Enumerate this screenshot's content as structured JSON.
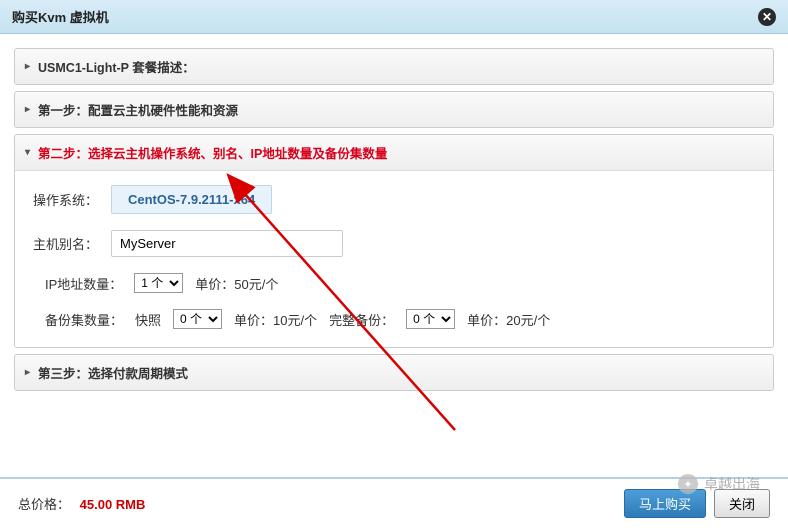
{
  "header": {
    "title": "购买Kvm 虚拟机"
  },
  "accordion": {
    "item1": {
      "label": "USMC1-Light-P 套餐描述："
    },
    "item2": {
      "label": "第一步：配置云主机硬件性能和资源"
    },
    "item3": {
      "label": "第二步：选择云主机操作系统、别名、IP地址数量及备份集数量"
    },
    "item4": {
      "label": "第三步：选择付款周期模式"
    }
  },
  "form": {
    "os_label": "操作系统：",
    "os_value": "CentOS-7.9.2111-x64",
    "alias_label": "主机别名：",
    "alias_value": "MyServer",
    "ip_label": "IP地址数量：",
    "ip_select": "1 个",
    "ip_unit": "单价：50元/个",
    "backup_label": "备份集数量：",
    "snapshot_label": "快照",
    "snapshot_select": "0 个",
    "snapshot_unit": "单价：10元/个",
    "full_label": "完整备份：",
    "full_select": "0 个",
    "full_unit": "单价：20元/个"
  },
  "footer": {
    "total_label": "总价格：",
    "total_price": "45.00 RMB",
    "buy_label": "马上购买",
    "close_label": "关闭"
  },
  "watermark": {
    "text": "卓越出海"
  }
}
